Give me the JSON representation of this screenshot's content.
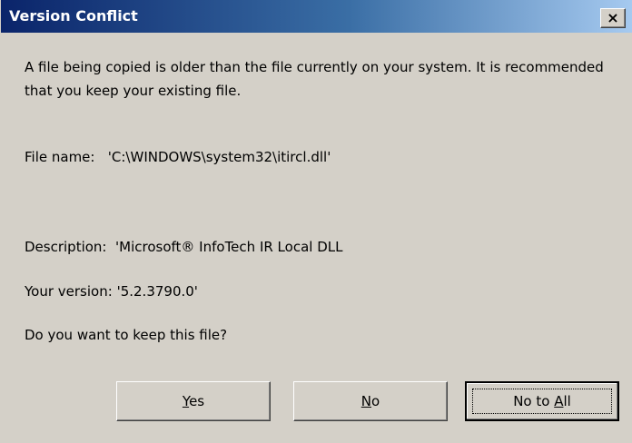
{
  "window": {
    "title": "Version Conflict",
    "close_label": "×"
  },
  "message": {
    "text": "A file being copied is older than the file currently on your system.  It is recommended that you keep your existing file."
  },
  "details": {
    "file_name_label": "File name:",
    "file_name_value": "'C:\\WINDOWS\\system32\\itircl.dll'",
    "description_label": "Description:",
    "description_value": "'Microsoft® InfoTech IR Local DLL",
    "version_label": "Your version:",
    "version_value": "'5.2.3790.0'",
    "question": "Do you want to keep this file?"
  },
  "buttons": {
    "yes_first": "Y",
    "yes_rest": "es",
    "no_first": "N",
    "no_rest": "o",
    "noall_pre": "No to ",
    "noall_accel": "A",
    "noall_post": "ll"
  },
  "colors": {
    "face": "#d4d0c8",
    "title_start": "#0a246a",
    "title_end": "#a6caf0"
  }
}
